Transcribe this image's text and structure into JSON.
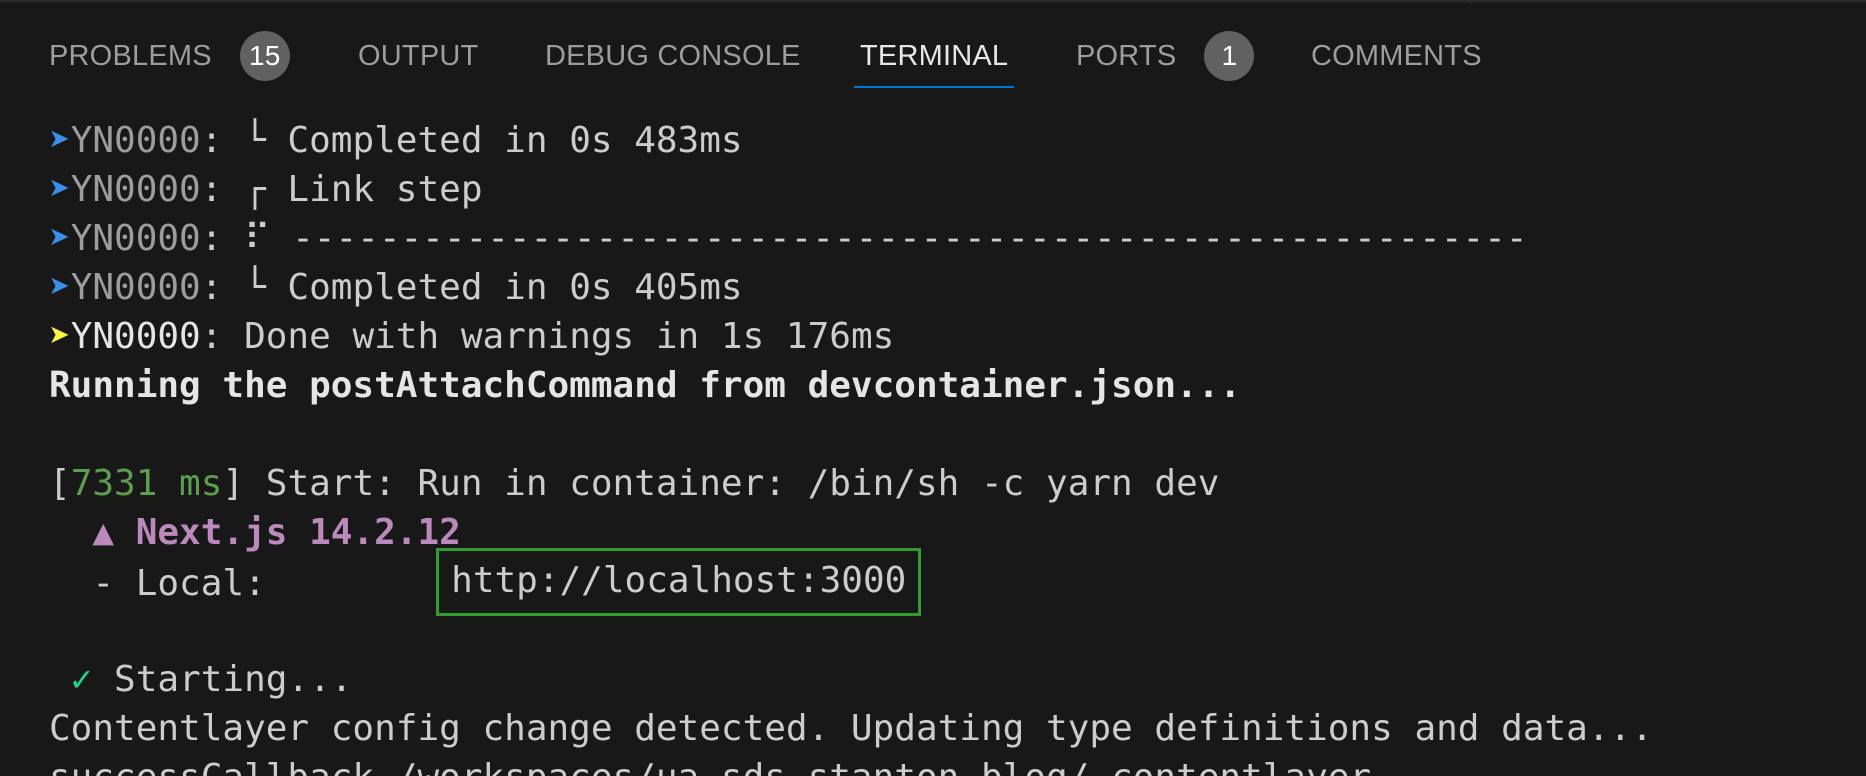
{
  "panel": {
    "tabs": [
      {
        "label": "PROBLEMS",
        "badge": "15"
      },
      {
        "label": "OUTPUT"
      },
      {
        "label": "DEBUG CONSOLE"
      },
      {
        "label": "TERMINAL",
        "active": true
      },
      {
        "label": "PORTS",
        "badge": "1"
      },
      {
        "label": "COMMENTS"
      }
    ]
  },
  "colors": {
    "background": "#181818",
    "accent_underline": "#0078d4",
    "link_border": "#2f9e2f",
    "arrow_info": "#3b8eea",
    "arrow_warning": "#f5f543"
  },
  "terminal": {
    "lines": [
      {
        "arrow": "➤",
        "prefix": "YN0000",
        "text": ": └ Completed in 0s 483ms"
      },
      {
        "arrow": "➤",
        "prefix": "YN0000",
        "text": ": ┌ Link step"
      },
      {
        "arrow": "➤",
        "prefix": "YN0000",
        "text": ": ⠏ ---------------------------------------------------------"
      },
      {
        "arrow": "➤",
        "prefix": "YN0000",
        "text": ": └ Completed in 0s 405ms"
      },
      {
        "arrow": "➤",
        "prefix": "YN0000",
        "text": ": Done with warnings in 1s 176ms"
      }
    ],
    "running": "Running the postAttachCommand from devcontainer.json...",
    "start": {
      "bracket_open": "[",
      "ms": "7331 ms",
      "bracket_close": "]",
      "text": " Start: Run in container: /bin/sh -c yarn dev"
    },
    "next": "  ▲ Next.js 14.2.12",
    "local_label": "  - Local:        ",
    "local_url": "http://localhost:3000",
    "starting_check": " ✓",
    "starting_text": " Starting...",
    "contentlayer": "Contentlayer config change detected. Updating type definitions and data...",
    "success": "successCallback /workspaces/ua-sds-stanton-blog/.contentlayer"
  }
}
